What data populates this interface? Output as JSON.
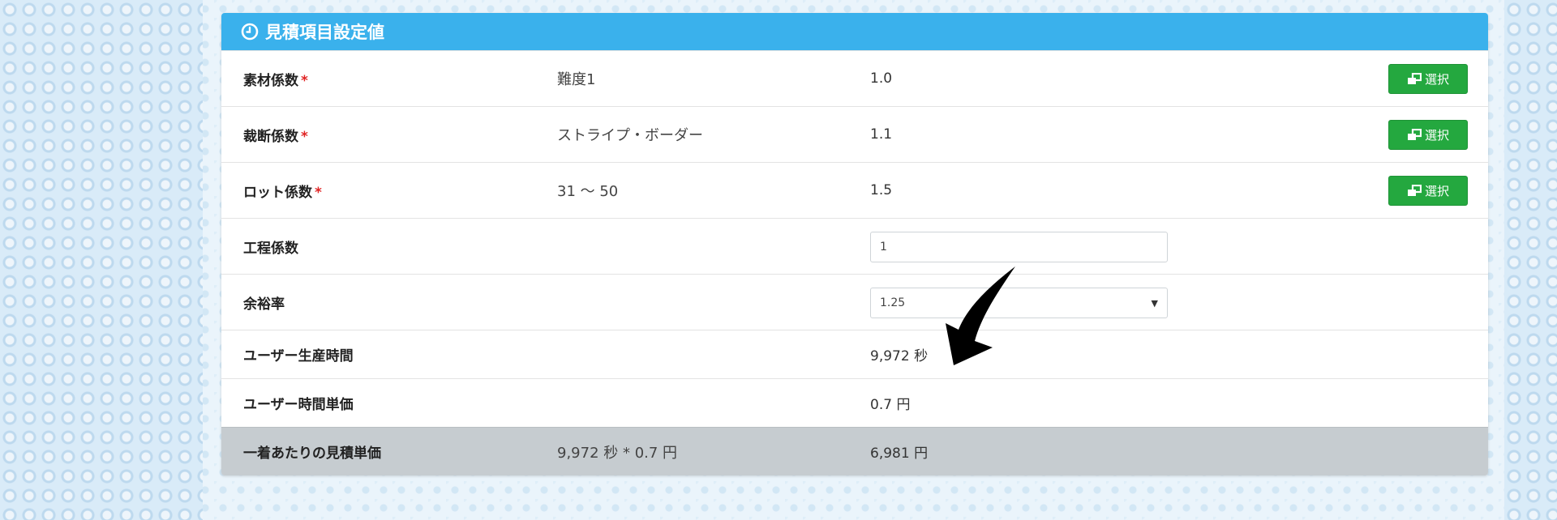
{
  "panel": {
    "title": "見積項目設定値",
    "header_color": "#3ab1ec",
    "select_button_color": "#24a83f",
    "accent_required_color": "#e02424"
  },
  "rows": [
    {
      "label": "素材係数",
      "required": "*",
      "value": "難度1",
      "coef": "1.0",
      "button": "選択"
    },
    {
      "label": "裁断係数",
      "required": "*",
      "value": "ストライプ・ボーダー",
      "coef": "1.1",
      "button": "選択"
    },
    {
      "label": "ロット係数",
      "required": "*",
      "value": "31 〜 50",
      "coef": "1.5",
      "button": "選択"
    }
  ],
  "process": {
    "label": "工程係数",
    "input_value": "1"
  },
  "margin_rate": {
    "label": "余裕率",
    "selected": "1.25"
  },
  "user_time": {
    "label": "ユーザー生産時間",
    "value": "9,972 秒"
  },
  "user_unit_price": {
    "label": "ユーザー時間単価",
    "value": "0.7 円"
  },
  "total": {
    "label": "一着あたりの見積単価",
    "formula": "9,972 秒 * 0.7 円",
    "value": "6,981 円"
  },
  "icons": {
    "header": "clock-icon",
    "button": "copy-icon",
    "annotation": "curved-arrow-icon"
  }
}
